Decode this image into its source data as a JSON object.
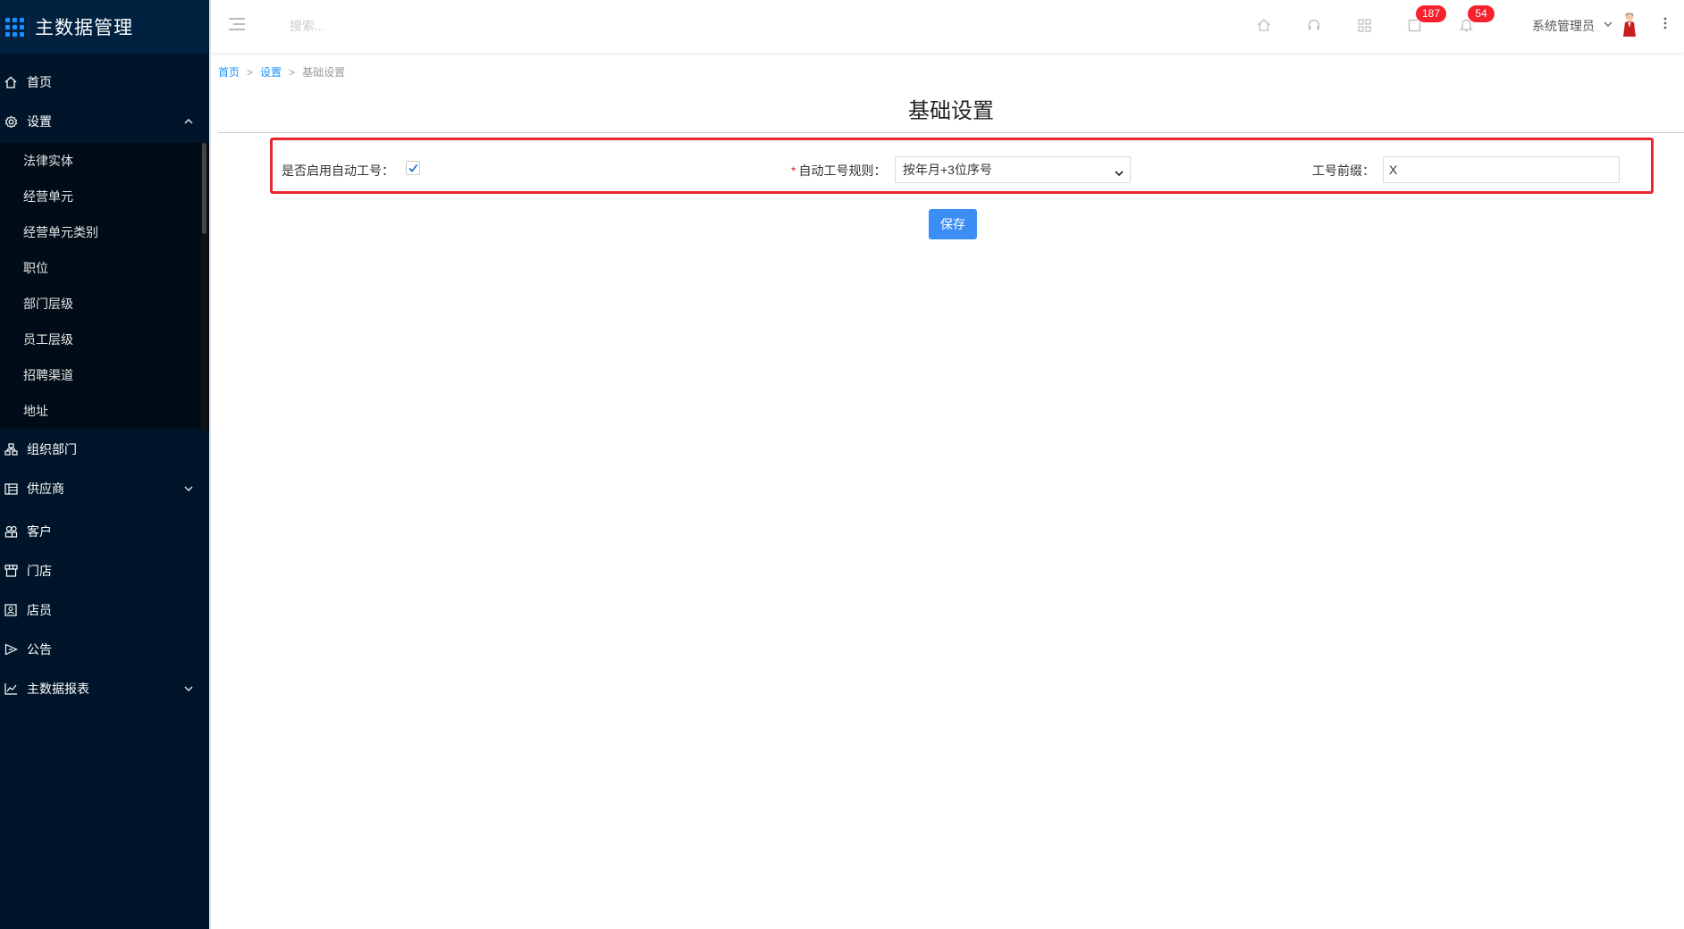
{
  "app": {
    "title": "主数据管理"
  },
  "sidebar": {
    "items": [
      {
        "label": "首页",
        "icon": "home-icon"
      },
      {
        "label": "设置",
        "icon": "gear-icon",
        "expanded": true
      },
      {
        "label": "组织部门",
        "icon": "org-icon"
      },
      {
        "label": "供应商",
        "icon": "supplier-icon",
        "has_children": true
      },
      {
        "label": "客户",
        "icon": "customer-icon"
      },
      {
        "label": "门店",
        "icon": "store-icon"
      },
      {
        "label": "店员",
        "icon": "clerk-icon"
      },
      {
        "label": "公告",
        "icon": "notice-icon"
      },
      {
        "label": "主数据报表",
        "icon": "report-icon",
        "has_children": true
      }
    ],
    "settings_children": [
      "法律实体",
      "经营单元",
      "经营单元类别",
      "职位",
      "部门层级",
      "员工层级",
      "招聘渠道",
      "地址"
    ]
  },
  "header": {
    "search_placeholder": "搜索...",
    "messages_count": "187",
    "notifications_count": "54",
    "user_name": "系统管理员"
  },
  "breadcrumb": {
    "home": "首页",
    "settings": "设置",
    "current": "基础设置",
    "separator": ">"
  },
  "page": {
    "title": "基础设置",
    "form": {
      "auto_number_label": "是否启用自动工号：",
      "auto_number_enabled": true,
      "rule_required_mark": "*",
      "rule_label": "自动工号规则：",
      "rule_value": "按年月+3位序号",
      "prefix_label": "工号前缀：",
      "prefix_value": "X"
    },
    "save_label": "保存"
  },
  "colors": {
    "sidebar_bg": "#001529",
    "accent": "#1890ff",
    "badge": "#f5222d",
    "highlight_frame": "#e8262e"
  }
}
